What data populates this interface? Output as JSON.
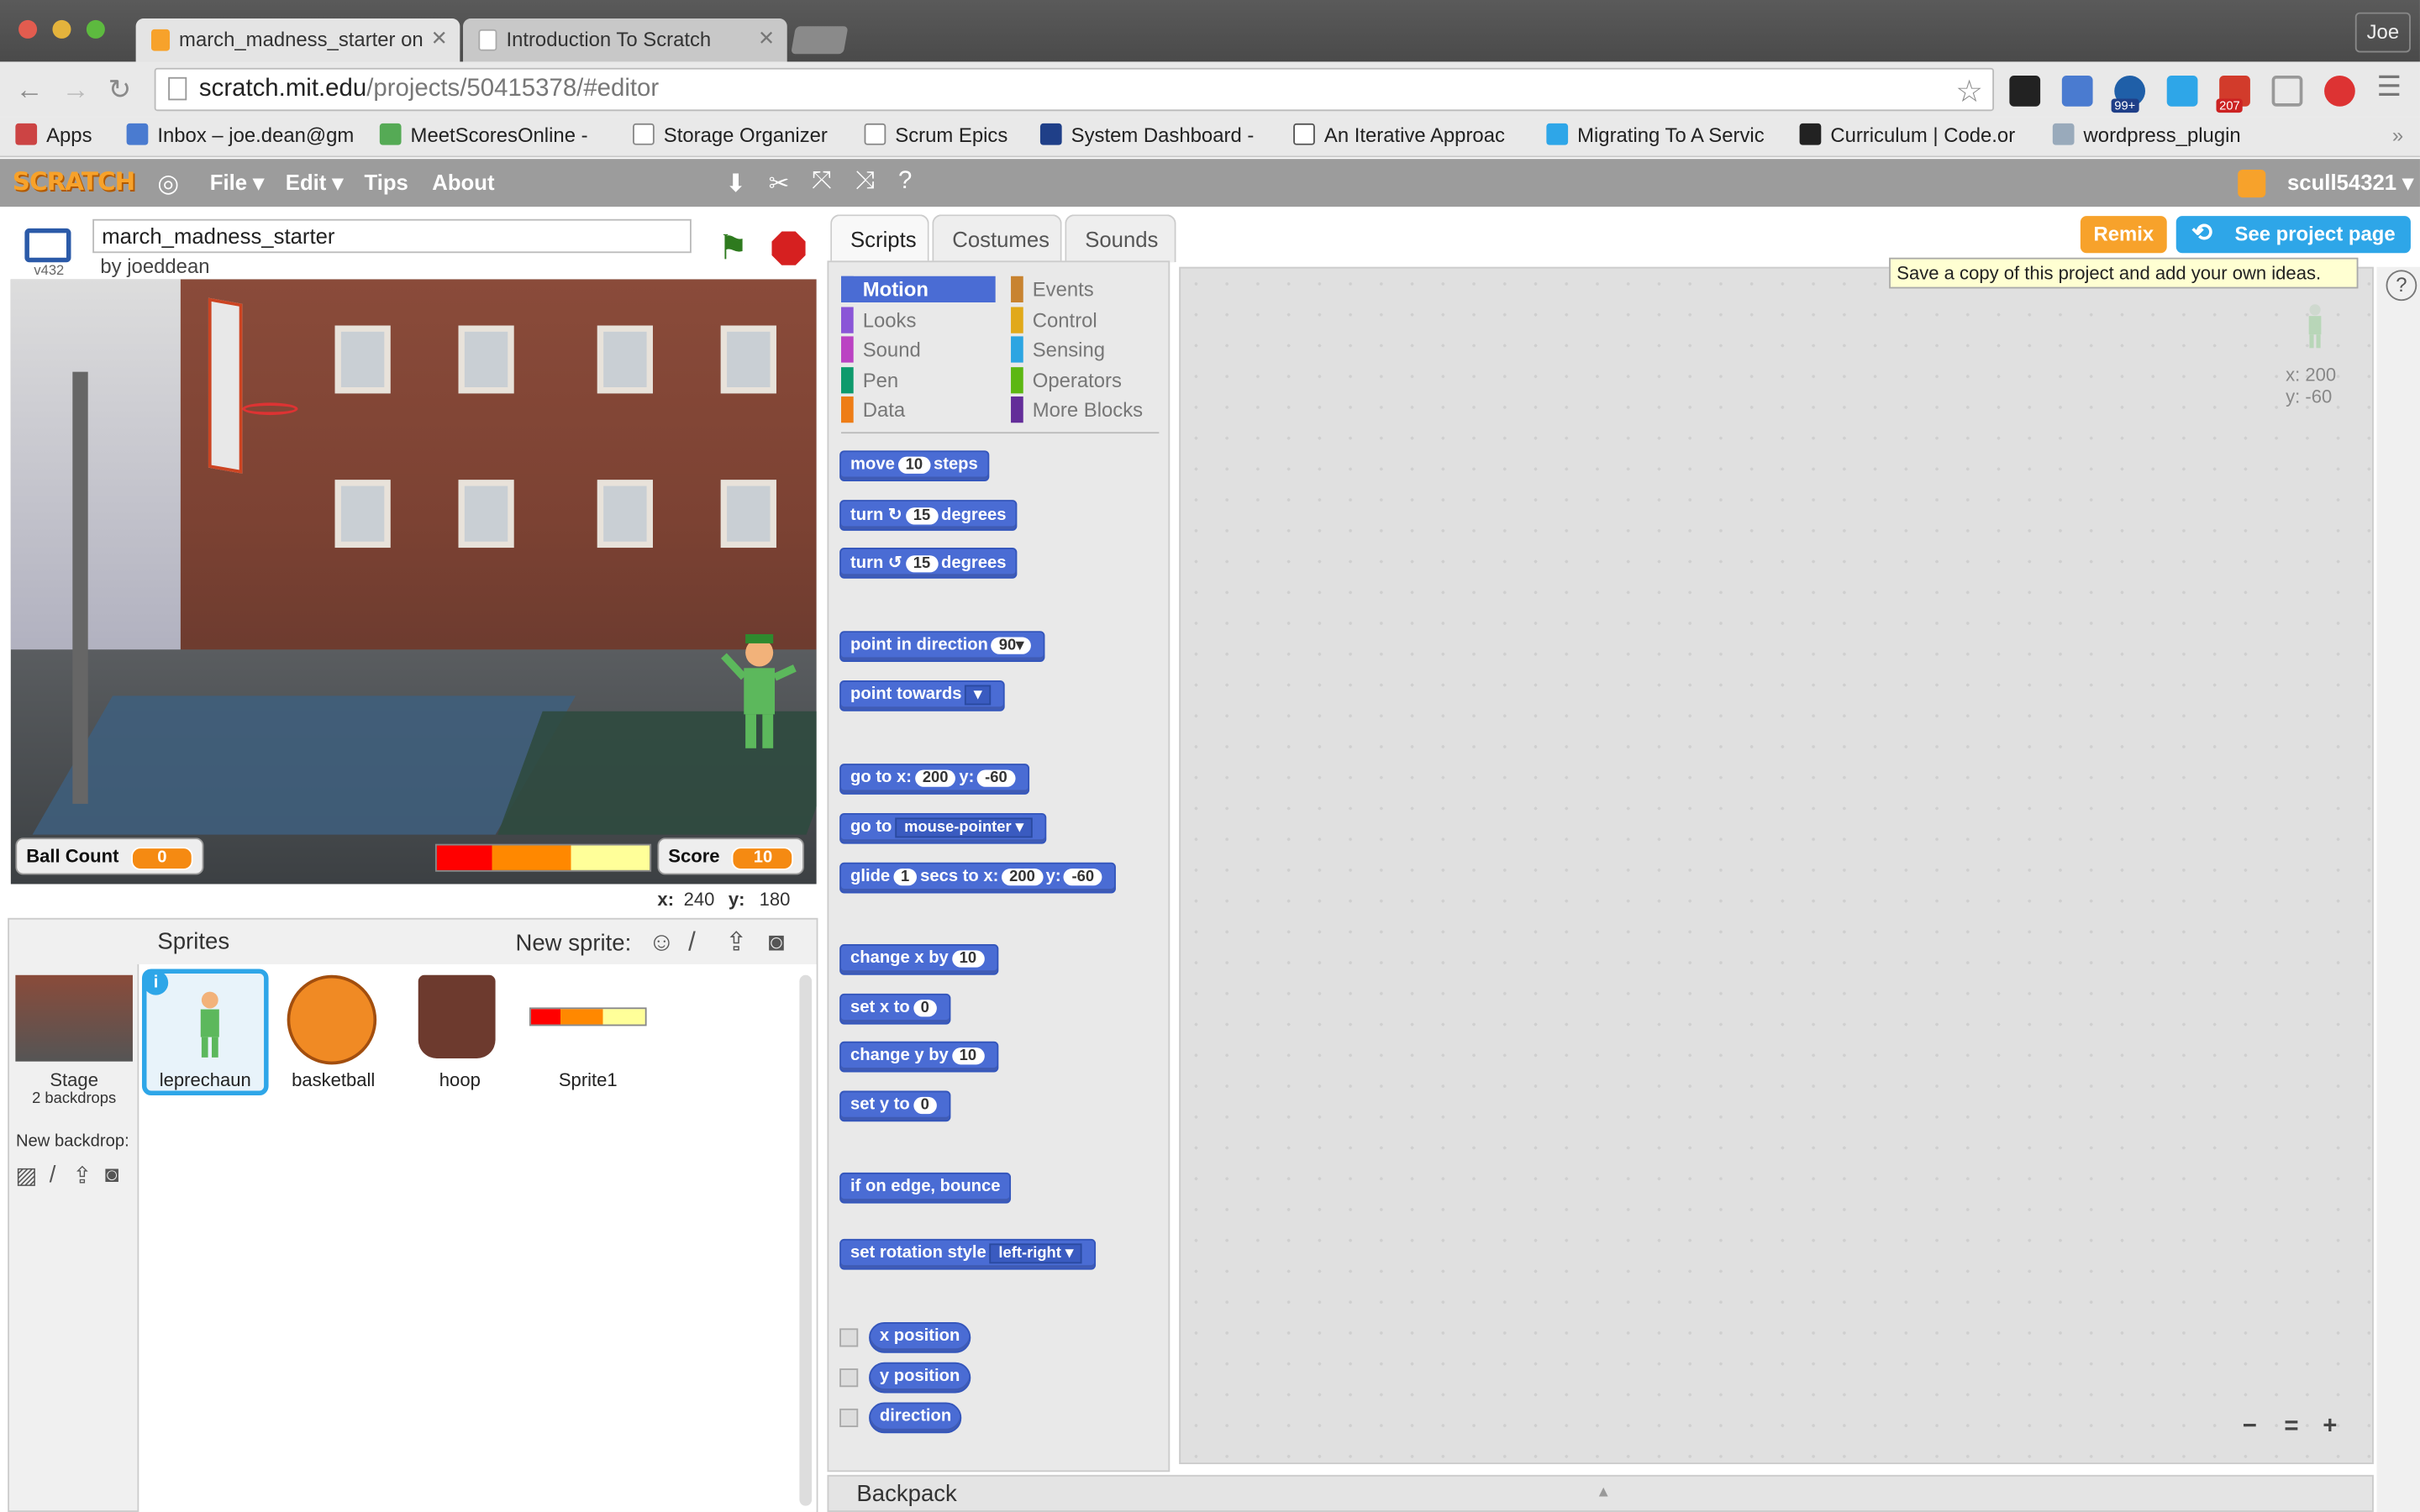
{
  "browser": {
    "tabs": [
      {
        "title": "march_madness_starter on"
      },
      {
        "title": "Introduction To Scratch"
      }
    ],
    "profile": "Joe",
    "url_host": "scratch.mit.edu",
    "url_path": "/projects/50415378/#editor",
    "bookmarks": [
      "Apps",
      "Inbox – joe.dean@gm",
      "MeetScoresOnline -",
      "Storage Organizer",
      "Scrum Epics",
      "System Dashboard -",
      "An Iterative Approac",
      "Migrating To A Servic",
      "Curriculum | Code.or",
      "wordpress_plugin"
    ],
    "badges": {
      "globe": "99+",
      "gmail": "207"
    }
  },
  "scratch_header": {
    "logo": "SCRATCH",
    "menus": [
      "File ▾",
      "Edit ▾",
      "Tips",
      "About"
    ],
    "user": "scull54321 ▾"
  },
  "project": {
    "title": "march_madness_starter",
    "byline": "by joeddean",
    "version": "v432"
  },
  "stage": {
    "monitors": [
      {
        "label": "Ball Count",
        "value": "0"
      },
      {
        "label": "Score",
        "value": "10"
      }
    ],
    "mouse_x_label": "x:",
    "mouse_x": "240",
    "mouse_y_label": "y:",
    "mouse_y": "180"
  },
  "sprites_pane": {
    "header": "Sprites",
    "new_sprite": "New sprite:",
    "stage_label": "Stage",
    "stage_backdrops": "2 backdrops",
    "new_backdrop": "New backdrop:",
    "sprites": [
      "leprechaun",
      "basketball",
      "hoop",
      "Sprite1"
    ]
  },
  "editor_tabs": [
    "Scripts",
    "Costumes",
    "Sounds"
  ],
  "categories_left": [
    "Motion",
    "Looks",
    "Sound",
    "Pen",
    "Data"
  ],
  "categories_right": [
    "Events",
    "Control",
    "Sensing",
    "Operators",
    "More Blocks"
  ],
  "category_colors": {
    "Motion": "#4a6cd4",
    "Looks": "#8a55d7",
    "Sound": "#bb42c3",
    "Pen": "#0e9a6c",
    "Data": "#ee7d16",
    "Events": "#c88330",
    "Control": "#e1a91a",
    "Sensing": "#2ca5e2",
    "Operators": "#5cb712",
    "More Blocks": "#632d99"
  },
  "blocks": {
    "move": [
      "move",
      "10",
      "steps"
    ],
    "turn_cw": [
      "turn",
      "↻",
      "15",
      "degrees"
    ],
    "turn_ccw": [
      "turn",
      "↺",
      "15",
      "degrees"
    ],
    "point_dir": [
      "point in direction",
      "90▾"
    ],
    "point_towards": [
      "point towards",
      "▾"
    ],
    "goto_xy": [
      "go to x:",
      "200",
      "y:",
      "-60"
    ],
    "goto": [
      "go to",
      "mouse-pointer ▾"
    ],
    "glide": [
      "glide",
      "1",
      "secs to x:",
      "200",
      "y:",
      "-60"
    ],
    "change_x": [
      "change x by",
      "10"
    ],
    "set_x": [
      "set x to",
      "0"
    ],
    "change_y": [
      "change y by",
      "10"
    ],
    "set_y": [
      "set y to",
      "0"
    ],
    "bounce": "if on edge, bounce",
    "rotation": [
      "set rotation style",
      "left-right ▾"
    ],
    "reporters": [
      "x position",
      "y position",
      "direction"
    ]
  },
  "actions": {
    "remix": "Remix",
    "see_page": "See project page",
    "tooltip": "Save a copy of this project and add your own ideas."
  },
  "sprite_info": {
    "x": "x: 200",
    "y": "y: -60"
  },
  "zoom": [
    "−",
    "=",
    "+"
  ],
  "backpack": "Backpack"
}
